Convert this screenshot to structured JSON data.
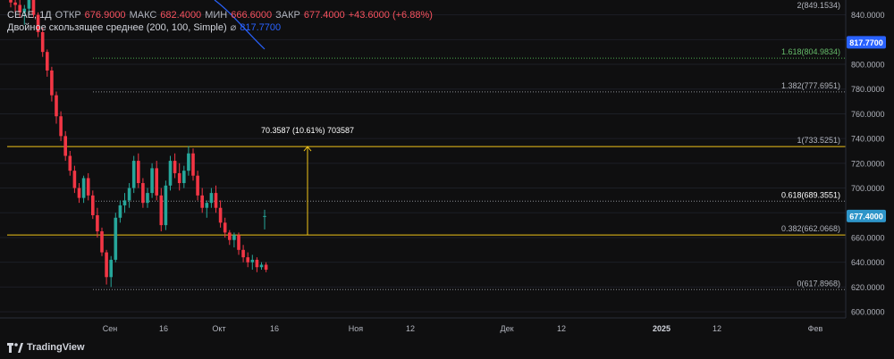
{
  "legend": {
    "symbol": "CEAE, 1Д",
    "open_label": "ОТКР",
    "open": "676.9000",
    "high_label": "МАКС",
    "high": "682.4000",
    "low_label": "МИН",
    "low": "666.6000",
    "close_label": "ЗАКР",
    "close": "677.4000",
    "change": "+43.6000 (+6.88%)",
    "ma_name": "Двойное скользящее среднее (200, 100, Simple)",
    "ma_symbol": "⌀",
    "ma_value": "817.7700"
  },
  "branding": {
    "logo_text": "TradingView"
  },
  "colors": {
    "up": "#26a69a",
    "down": "#f23645",
    "fib": "#f0c419",
    "ma": "#2962ff",
    "last_price": "#2e95c9"
  },
  "chart_data": {
    "type": "candlestick",
    "y_ticks": [
      "600.0000",
      "620.0000",
      "640.0000",
      "660.0000",
      "680.0000",
      "700.0000",
      "720.0000",
      "740.0000",
      "760.0000",
      "780.0000",
      "800.0000",
      "820.0000",
      "840.0000"
    ],
    "ylim": [
      595,
      852
    ],
    "x_ticks": [
      "Сен",
      "16",
      "Окт",
      "16",
      "Ноя",
      "12",
      "Дек",
      "12",
      "2025",
      "12",
      "Фев"
    ],
    "last_price_label": "677.4000",
    "ma_price_label": "817.7700",
    "fibonacci": [
      {
        "level": "0",
        "price": 617.8968,
        "label": "0(617.8968)",
        "label_color": "#b2b5be"
      },
      {
        "level": "0.382",
        "price": 662.0668,
        "label": "0.382(662.0668)",
        "label_color": "#b2b5be"
      },
      {
        "level": "0.618",
        "price": 689.3551,
        "label": "0.618(689.3551)",
        "label_color": "#ffffff"
      },
      {
        "level": "1",
        "price": 733.5251,
        "label": "1(733.5251)",
        "label_color": "#b2b5be"
      },
      {
        "level": "1.382",
        "price": 777.6951,
        "label": "1.382(777.6951)",
        "label_color": "#b2b5be"
      },
      {
        "level": "1.618",
        "price": 804.9834,
        "label": "1.618(804.9834)",
        "label_color": "#66bb6a"
      }
    ],
    "top_partial_label": "2(849.1534)",
    "measure": {
      "from": 662.0668,
      "to": 733.5251,
      "label": "70.3587 (10.61%) 703587"
    },
    "candles": [
      [
        856,
        858,
        846,
        850
      ],
      [
        850,
        855,
        842,
        848
      ],
      [
        848,
        852,
        838,
        842
      ],
      [
        842,
        848,
        832,
        845
      ],
      [
        845,
        853,
        840,
        852
      ],
      [
        852,
        854,
        838,
        840
      ],
      [
        840,
        842,
        822,
        826
      ],
      [
        826,
        830,
        806,
        810
      ],
      [
        810,
        812,
        790,
        795
      ],
      [
        795,
        798,
        770,
        775
      ],
      [
        775,
        778,
        752,
        758
      ],
      [
        758,
        762,
        738,
        742
      ],
      [
        742,
        746,
        722,
        726
      ],
      [
        726,
        730,
        710,
        714
      ],
      [
        714,
        718,
        696,
        700
      ],
      [
        700,
        704,
        688,
        692
      ],
      [
        692,
        710,
        688,
        708
      ],
      [
        708,
        712,
        690,
        694
      ],
      [
        694,
        698,
        675,
        678
      ],
      [
        678,
        684,
        660,
        665
      ],
      [
        665,
        668,
        645,
        648
      ],
      [
        648,
        650,
        622,
        628
      ],
      [
        628,
        645,
        620,
        642
      ],
      [
        642,
        680,
        640,
        676
      ],
      [
        676,
        690,
        672,
        686
      ],
      [
        686,
        696,
        680,
        690
      ],
      [
        690,
        704,
        684,
        700
      ],
      [
        700,
        726,
        696,
        722
      ],
      [
        722,
        728,
        700,
        704
      ],
      [
        704,
        708,
        684,
        688
      ],
      [
        688,
        700,
        684,
        696
      ],
      [
        696,
        720,
        692,
        716
      ],
      [
        716,
        722,
        690,
        694
      ],
      [
        694,
        700,
        665,
        670
      ],
      [
        670,
        706,
        666,
        702
      ],
      [
        702,
        726,
        698,
        722
      ],
      [
        722,
        728,
        708,
        712
      ],
      [
        712,
        720,
        698,
        704
      ],
      [
        704,
        718,
        700,
        714
      ],
      [
        714,
        734,
        710,
        728
      ],
      [
        728,
        732,
        706,
        710
      ],
      [
        710,
        714,
        690,
        694
      ],
      [
        694,
        700,
        680,
        684
      ],
      [
        684,
        690,
        676,
        688
      ],
      [
        688,
        700,
        684,
        696
      ],
      [
        696,
        702,
        680,
        684
      ],
      [
        684,
        690,
        668,
        672
      ],
      [
        672,
        676,
        660,
        664
      ],
      [
        664,
        666,
        654,
        658
      ],
      [
        658,
        664,
        652,
        662
      ],
      [
        662,
        664,
        646,
        650
      ],
      [
        650,
        654,
        640,
        644
      ],
      [
        644,
        648,
        636,
        640
      ],
      [
        640,
        646,
        634,
        642
      ],
      [
        642,
        644,
        632,
        636
      ],
      [
        636,
        640,
        634,
        638
      ],
      [
        638,
        640,
        632,
        634
      ],
      [
        676.9,
        682.4,
        666.6,
        677.4
      ]
    ]
  }
}
